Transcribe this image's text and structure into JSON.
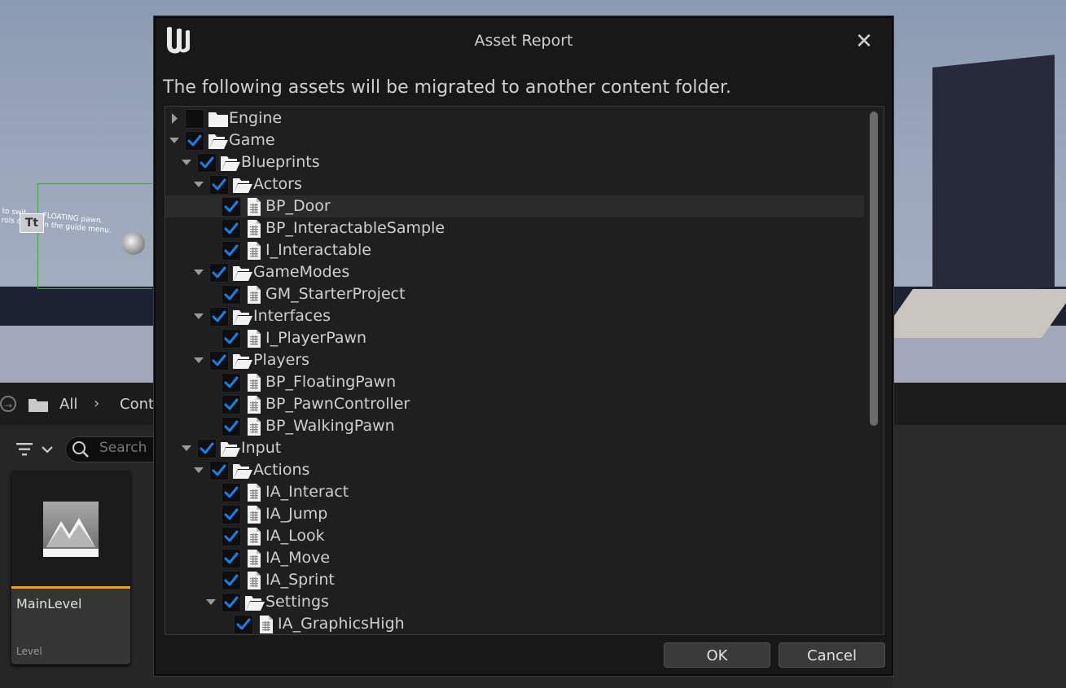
{
  "viewport": {
    "tooltip_line1": "to swit",
    "tooltip_line2": "rols cha",
    "tooltip_b1": "FLOATING pawn.",
    "tooltip_b2": "in the guide menu.",
    "tt_glyph": "Tt"
  },
  "content_browser": {
    "path_all": "All",
    "path_sep": "›",
    "path_next": "Cont",
    "search_placeholder": "Search",
    "asset": {
      "name": "MainLevel",
      "type": "Level"
    },
    "accent_color": "#f0a020"
  },
  "dialog": {
    "title": "Asset Report",
    "close_glyph": "✕",
    "message": "The following assets will be migrated to another content folder.",
    "ok_label": "OK",
    "cancel_label": "Cancel",
    "check_color": "#1a7fe8"
  },
  "tree": [
    {
      "label": "Engine",
      "depth": 0,
      "kind": "folder",
      "expanded": false,
      "checked": false
    },
    {
      "label": "Game",
      "depth": 0,
      "kind": "folder",
      "expanded": true,
      "checked": true
    },
    {
      "label": "Blueprints",
      "depth": 1,
      "kind": "folder",
      "expanded": true,
      "checked": true
    },
    {
      "label": "Actors",
      "depth": 2,
      "kind": "folder",
      "expanded": true,
      "checked": true
    },
    {
      "label": "BP_Door",
      "depth": 3,
      "kind": "file",
      "checked": true,
      "selected": true
    },
    {
      "label": "BP_InteractableSample",
      "depth": 3,
      "kind": "file",
      "checked": true
    },
    {
      "label": "I_Interactable",
      "depth": 3,
      "kind": "file",
      "checked": true
    },
    {
      "label": "GameModes",
      "depth": 2,
      "kind": "folder",
      "expanded": true,
      "checked": true
    },
    {
      "label": "GM_StarterProject",
      "depth": 3,
      "kind": "file",
      "checked": true
    },
    {
      "label": "Interfaces",
      "depth": 2,
      "kind": "folder",
      "expanded": true,
      "checked": true
    },
    {
      "label": "I_PlayerPawn",
      "depth": 3,
      "kind": "file",
      "checked": true
    },
    {
      "label": "Players",
      "depth": 2,
      "kind": "folder",
      "expanded": true,
      "checked": true
    },
    {
      "label": "BP_FloatingPawn",
      "depth": 3,
      "kind": "file",
      "checked": true
    },
    {
      "label": "BP_PawnController",
      "depth": 3,
      "kind": "file",
      "checked": true
    },
    {
      "label": "BP_WalkingPawn",
      "depth": 3,
      "kind": "file",
      "checked": true
    },
    {
      "label": "Input",
      "depth": 1,
      "kind": "folder",
      "expanded": true,
      "checked": true
    },
    {
      "label": "Actions",
      "depth": 2,
      "kind": "folder",
      "expanded": true,
      "checked": true
    },
    {
      "label": "IA_Interact",
      "depth": 3,
      "kind": "file",
      "checked": true
    },
    {
      "label": "IA_Jump",
      "depth": 3,
      "kind": "file",
      "checked": true
    },
    {
      "label": "IA_Look",
      "depth": 3,
      "kind": "file",
      "checked": true
    },
    {
      "label": "IA_Move",
      "depth": 3,
      "kind": "file",
      "checked": true
    },
    {
      "label": "IA_Sprint",
      "depth": 3,
      "kind": "file",
      "checked": true
    },
    {
      "label": "Settings",
      "depth": 3,
      "kind": "folder",
      "expanded": true,
      "checked": true
    },
    {
      "label": "IA_GraphicsHigh",
      "depth": 4,
      "kind": "file",
      "checked": true
    }
  ]
}
